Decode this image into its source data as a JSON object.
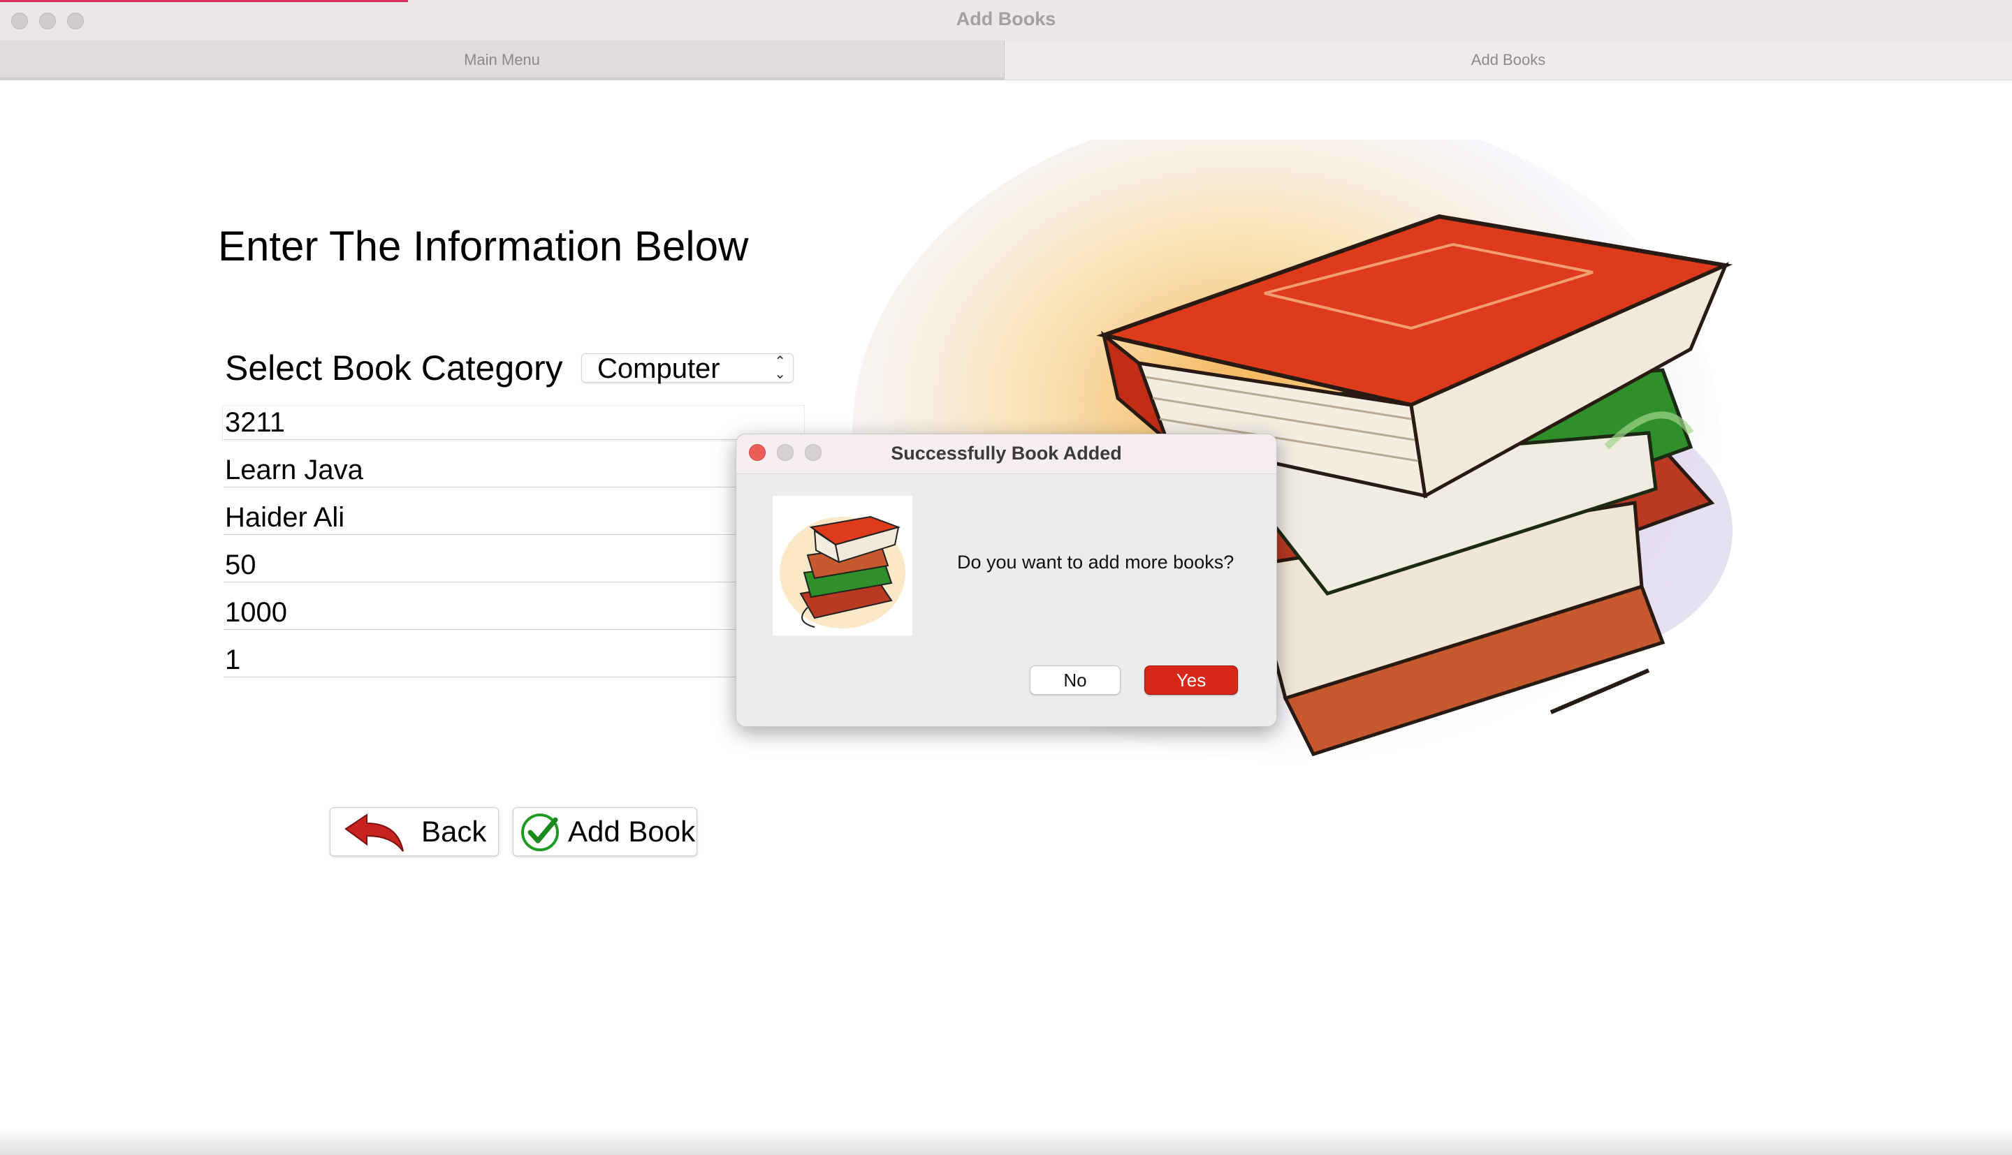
{
  "window": {
    "title": "Add Books"
  },
  "tabs": [
    {
      "label": "Main Menu",
      "selected": false
    },
    {
      "label": "Add Books",
      "selected": true
    }
  ],
  "form": {
    "heading": "Enter The Information Below",
    "category_label": "Select Book Category",
    "category_value": "Computer",
    "fields": [
      "3211",
      "Learn Java",
      "Haider Ali",
      "50",
      "1000",
      "1"
    ]
  },
  "buttons": {
    "back": "Back",
    "add_book": "Add Book"
  },
  "dialog": {
    "title": "Successfully Book Added",
    "message": "Do you want to add more books?",
    "no_label": "No",
    "yes_label": "Yes"
  },
  "colors": {
    "accent": "#d62718",
    "tab_active_bg": "#efebed",
    "dialog_bg": "#ececec"
  },
  "icons": {
    "back": "curved-arrow-back-icon",
    "add": "green-check-icon",
    "select": "up-down-chevron-icon"
  }
}
